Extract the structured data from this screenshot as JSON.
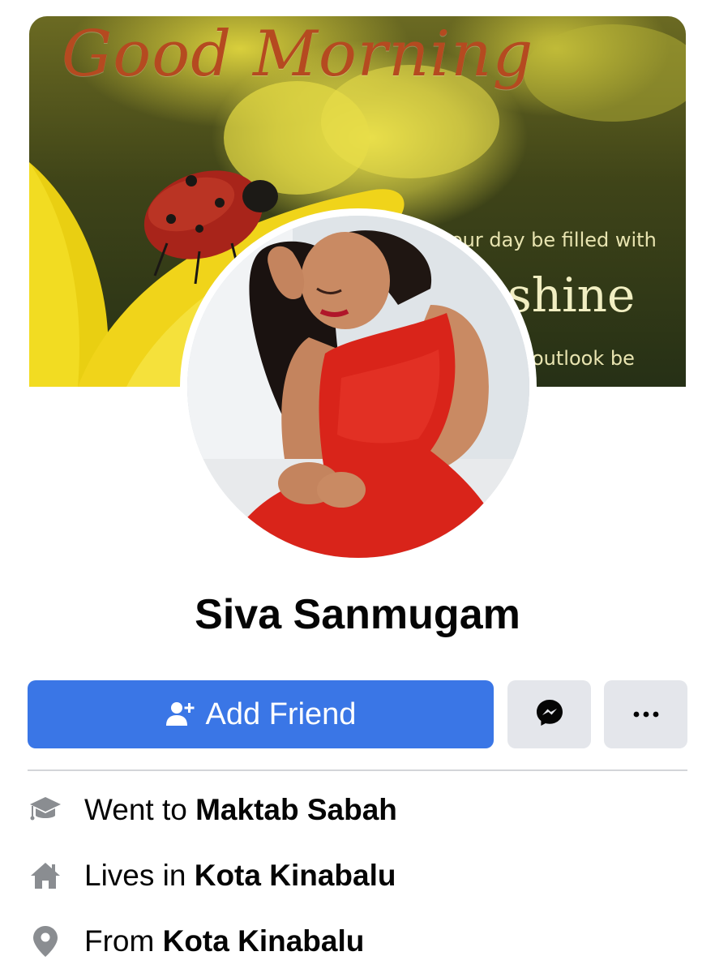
{
  "cover": {
    "title": "Good Morning",
    "line1": "our day be filled with",
    "line2": "shine",
    "line3": "outlook be"
  },
  "profile": {
    "name": "Siva Sanmugam"
  },
  "actions": {
    "add_friend_label": "Add Friend",
    "add_friend_icon": "person-add-icon",
    "messenger_icon": "messenger-icon",
    "more_label": "•••"
  },
  "intro": [
    {
      "icon": "education-cap-icon",
      "prefix": "Went to ",
      "value": "Maktab Sabah"
    },
    {
      "icon": "home-icon",
      "prefix": "Lives in ",
      "value": "Kota Kinabalu"
    },
    {
      "icon": "location-pin-icon",
      "prefix": "From ",
      "value": "Kota Kinabalu"
    }
  ],
  "colors": {
    "primary": "#3a76e6",
    "secondary_button": "#e4e6eb",
    "text": "#050505",
    "icon_gray": "#8a8d91",
    "divider": "#d3d5d9"
  }
}
